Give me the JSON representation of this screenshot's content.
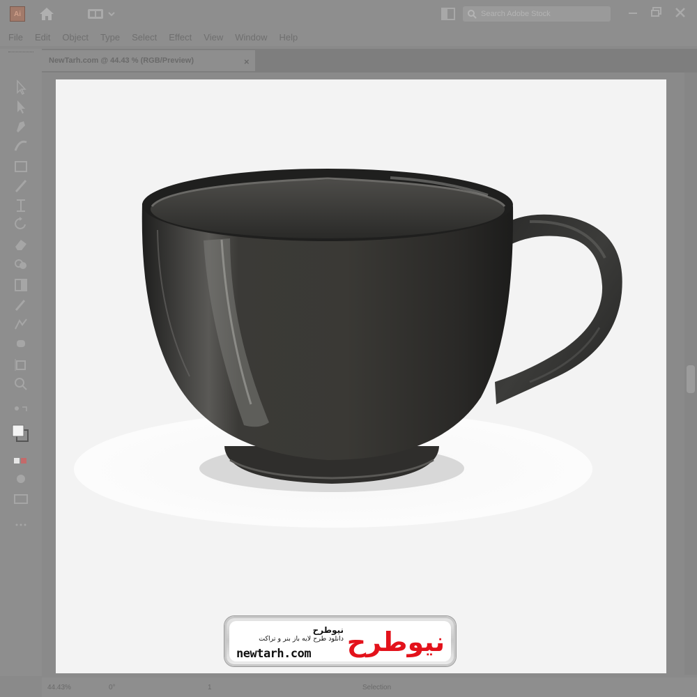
{
  "app": {
    "logo_text": "Ai",
    "search_placeholder": "Search Adobe Stock"
  },
  "menu": [
    "File",
    "Edit",
    "Object",
    "Type",
    "Select",
    "Effect",
    "View",
    "Window",
    "Help"
  ],
  "document_tab": {
    "title": "NewTarh.com @ 44.43 % (RGB/Preview)",
    "close": "×"
  },
  "status": {
    "zoom": "44.43%",
    "rotation": "0°",
    "artboard": "1",
    "tool": "Selection"
  },
  "watermark": {
    "brand_fa": "نیوطرح",
    "tagline_fa": "دانلود طرح لایه باز بنر و تراکت",
    "site": "newtarh.com",
    "logo_fa": "نیوطرح",
    "color_red": "#e3121b",
    "color_blue": "#1f5fd0"
  },
  "artwork": {
    "subject": "black-ceramic-cup",
    "cup_color": "#353431",
    "canvas_color": "#f3f3f3"
  }
}
